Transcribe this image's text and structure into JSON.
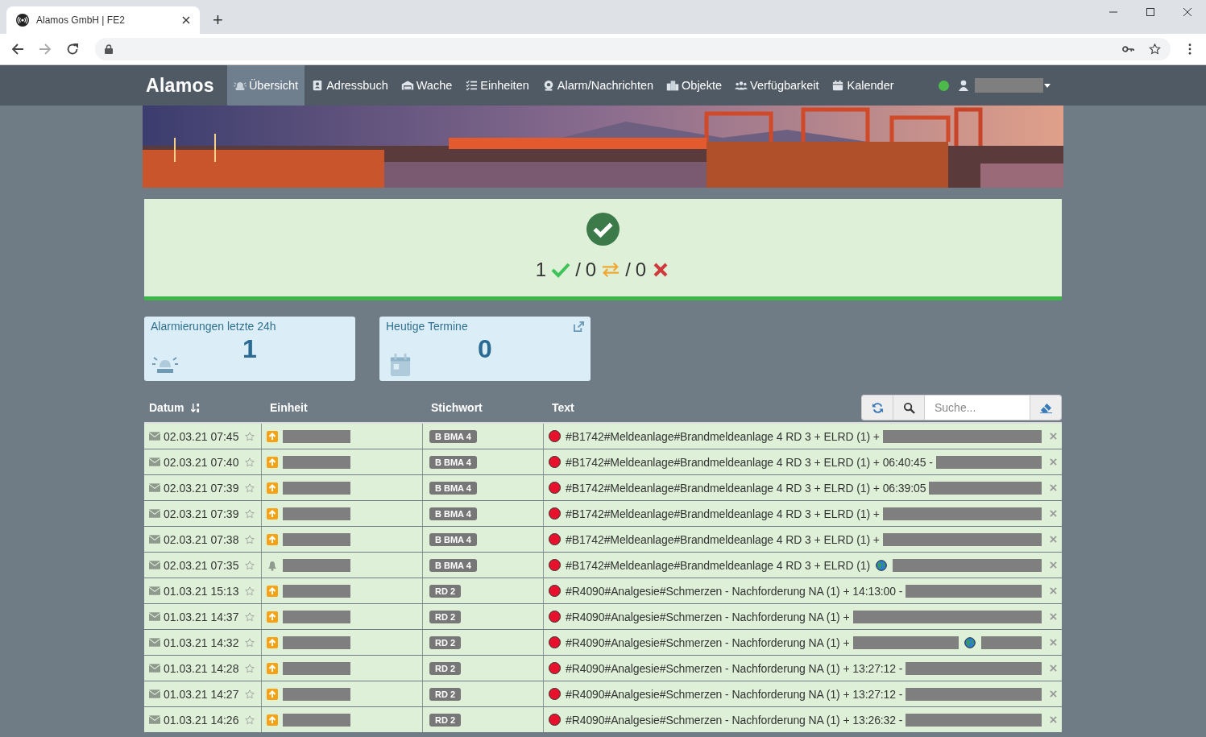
{
  "browser": {
    "tab_title": "Alamos GmbH | FE2",
    "new_tab": "+"
  },
  "navbar": {
    "brand": "Alamos",
    "online": true,
    "items": [
      {
        "label": "Übersicht",
        "kind": "siren",
        "selected": true
      },
      {
        "label": "Adressbuch",
        "kind": "book",
        "selected": false
      },
      {
        "label": "Wache",
        "kind": "garage",
        "selected": false
      },
      {
        "label": "Einheiten",
        "kind": "list",
        "selected": false
      },
      {
        "label": "Alarm/Nachrichten",
        "kind": "speaker",
        "selected": false
      },
      {
        "label": "Objekte",
        "kind": "building",
        "selected": false
      },
      {
        "label": "Verfügbarkeit",
        "kind": "people",
        "selected": false
      },
      {
        "label": "Kalender",
        "kind": "calendar",
        "selected": false
      }
    ]
  },
  "status": {
    "ok": "1",
    "transfer": "0",
    "fail": "0",
    "sep1": "/",
    "sep2": "/"
  },
  "cards": [
    {
      "title": "Alarmierungen letzte 24h",
      "value": "1",
      "kind": "siren",
      "external_link": false
    },
    {
      "title": "Heutige Termine",
      "value": "0",
      "kind": "calendar",
      "external_link": true
    }
  ],
  "table": {
    "columns": [
      "Datum",
      "Einheit",
      "Stichwort",
      "Text"
    ],
    "search": {
      "placeholder": "Suche..."
    },
    "rows": [
      {
        "date": "02.03.21 07:45",
        "starred": false,
        "kind": "alarm",
        "keyword": "B BMA 4",
        "text": "#B1742#Meldeanlage#Brandmeldeanlage 4 RD 3 + ELRD (1) +",
        "globe": false
      },
      {
        "date": "02.03.21 07:40",
        "starred": false,
        "kind": "alarm",
        "keyword": "B BMA 4",
        "text": "#B1742#Meldeanlage#Brandmeldeanlage 4 RD 3 + ELRD (1) + 06:40:45 -",
        "globe": false
      },
      {
        "date": "02.03.21 07:39",
        "starred": false,
        "kind": "alarm",
        "keyword": "B BMA 4",
        "text": "#B1742#Meldeanlage#Brandmeldeanlage 4 RD 3 + ELRD (1) + 06:39:05",
        "globe": false
      },
      {
        "date": "02.03.21 07:39",
        "starred": false,
        "kind": "alarm",
        "keyword": "B BMA 4",
        "text": "#B1742#Meldeanlage#Brandmeldeanlage 4 RD 3 + ELRD (1) +",
        "globe": false
      },
      {
        "date": "02.03.21 07:38",
        "starred": false,
        "kind": "alarm",
        "keyword": "B BMA 4",
        "text": "#B1742#Meldeanlage#Brandmeldeanlage 4 RD 3 + ELRD (1) +",
        "globe": false
      },
      {
        "date": "02.03.21 07:35",
        "starred": false,
        "kind": "bell",
        "keyword": "B BMA 4",
        "text": "#B1742#Meldeanlage#Brandmeldeanlage 4 RD 3 + ELRD (1)",
        "globe": true,
        "globe_after_redaction": false
      },
      {
        "date": "01.03.21 15:13",
        "starred": false,
        "kind": "alarm",
        "keyword": "RD 2",
        "text": "#R4090#Analgesie#Schmerzen - Nachforderung NA (1) + 14:13:00 -",
        "globe": false
      },
      {
        "date": "01.03.21 14:37",
        "starred": false,
        "kind": "alarm",
        "keyword": "RD 2",
        "text": "#R4090#Analgesie#Schmerzen - Nachforderung NA (1) +",
        "globe": false
      },
      {
        "date": "01.03.21 14:32",
        "starred": false,
        "kind": "alarm",
        "keyword": "RD 2",
        "text": "#R4090#Analgesie#Schmerzen - Nachforderung NA (1) +",
        "globe": true,
        "globe_after_redaction": true
      },
      {
        "date": "01.03.21 14:28",
        "starred": false,
        "kind": "alarm",
        "keyword": "RD 2",
        "text": "#R4090#Analgesie#Schmerzen - Nachforderung NA (1) + 13:27:12 -",
        "globe": false
      },
      {
        "date": "01.03.21 14:27",
        "starred": false,
        "kind": "alarm",
        "keyword": "RD 2",
        "text": "#R4090#Analgesie#Schmerzen - Nachforderung NA (1) + 13:27:12 -",
        "globe": false
      },
      {
        "date": "01.03.21 14:26",
        "starred": false,
        "kind": "alarm",
        "keyword": "RD 2",
        "text": "#R4090#Analgesie#Schmerzen - Nachforderung NA (1) + 13:26:32 -",
        "globe": false
      }
    ]
  }
}
